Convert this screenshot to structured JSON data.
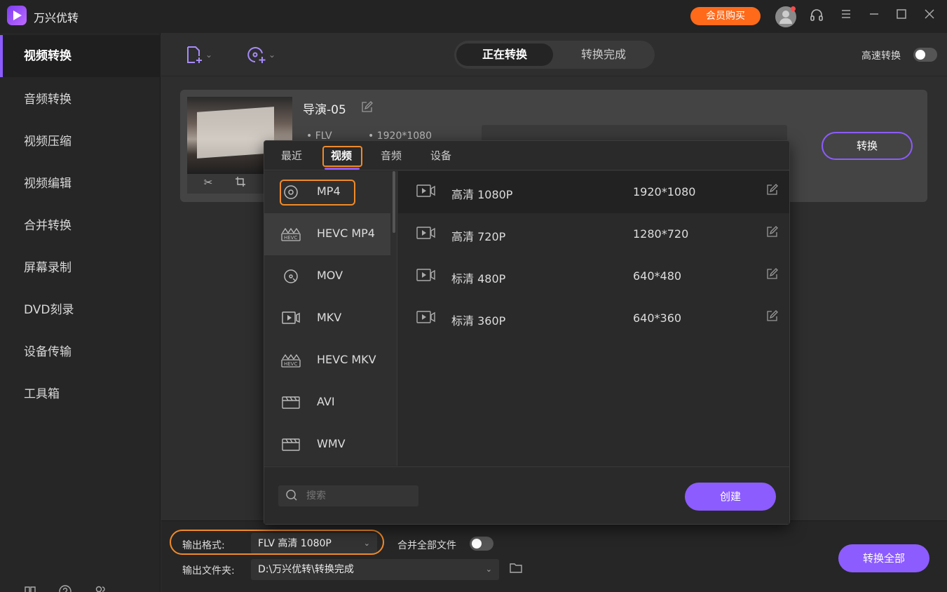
{
  "app": {
    "title": "万兴优转",
    "vip_button": "会员购买"
  },
  "sidebar": {
    "items": [
      {
        "label": "视频转换",
        "active": true
      },
      {
        "label": "音频转换"
      },
      {
        "label": "视频压缩"
      },
      {
        "label": "视频编辑"
      },
      {
        "label": "合并转换"
      },
      {
        "label": "屏幕录制"
      },
      {
        "label": "DVD刻录"
      },
      {
        "label": "设备传输"
      },
      {
        "label": "工具箱"
      }
    ],
    "bottom_icons": [
      "book-icon",
      "help-icon",
      "users-icon"
    ]
  },
  "toolbar": {
    "tabs": {
      "active": "正在转换",
      "done": "转换完成"
    },
    "speed_label": "高速转换"
  },
  "file": {
    "name": "导演-05",
    "format": "FLV",
    "resolution": "1920*1080",
    "convert_button": "转换"
  },
  "panel": {
    "tabs": [
      "最近",
      "视频",
      "音频",
      "设备"
    ],
    "active_tab": "视频",
    "formats": [
      "MP4",
      "HEVC MP4",
      "MOV",
      "MKV",
      "HEVC MKV",
      "AVI",
      "WMV"
    ],
    "resolutions": [
      {
        "name": "高清 1080P",
        "size": "1920*1080"
      },
      {
        "name": "高清 720P",
        "size": "1280*720"
      },
      {
        "name": "标清 480P",
        "size": "640*480"
      },
      {
        "name": "标清 360P",
        "size": "640*360"
      }
    ],
    "search_placeholder": "搜索",
    "create_button": "创建"
  },
  "bottom": {
    "output_format_label": "输出格式:",
    "output_format_value": "FLV 高清 1080P",
    "merge_label": "合并全部文件",
    "output_folder_label": "输出文件夹:",
    "output_folder_value": "D:\\万兴优转\\转换完成",
    "convert_all_button": "转换全部"
  },
  "colors": {
    "accent": "#8c5cff",
    "vip": "#ff6a1a",
    "highlight": "#f08a2a"
  }
}
